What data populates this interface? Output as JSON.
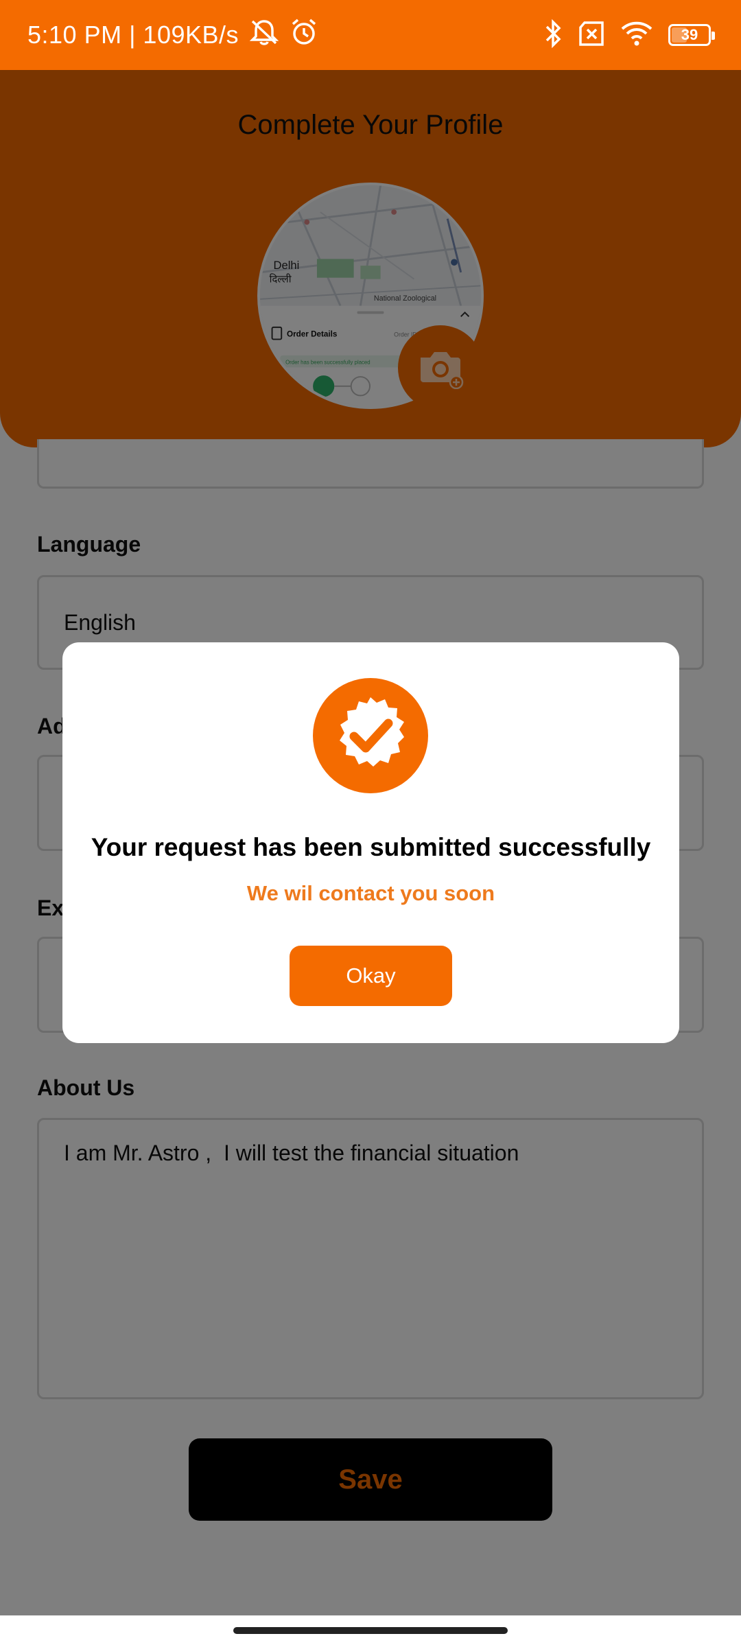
{
  "status_bar": {
    "time_speed": "5:10 PM | 109KB/s",
    "battery": "39",
    "icons": [
      "mute-notifications-icon",
      "alarm-icon",
      "bluetooth-icon",
      "sim-x-icon",
      "wifi-icon",
      "battery-icon"
    ]
  },
  "header": {
    "title": "Complete Your Profile",
    "avatar_map": {
      "city_en": "Delhi",
      "city_hi": "दिल्ली",
      "place": "National Zoological",
      "sheet_title": "Order Details",
      "sheet_order": "Order ID:",
      "sheet_message": "Order has been successfully placed"
    }
  },
  "form": {
    "language_label": "Language",
    "language_value": "English",
    "address_label_partial": "Ad",
    "experience_label_partial": "Ex",
    "about_label": "About Us",
    "about_value": "I am Mr. Astro ,  I will test the financial situation",
    "save_label": "Save"
  },
  "dialog": {
    "title": "Your request has been submitted successfully",
    "subtitle": "We wil contact you soon",
    "ok_label": "Okay"
  },
  "colors": {
    "brand_orange": "#f46b00",
    "subtitle_orange": "#ee7a1d",
    "save_button_bg": "#000000"
  }
}
